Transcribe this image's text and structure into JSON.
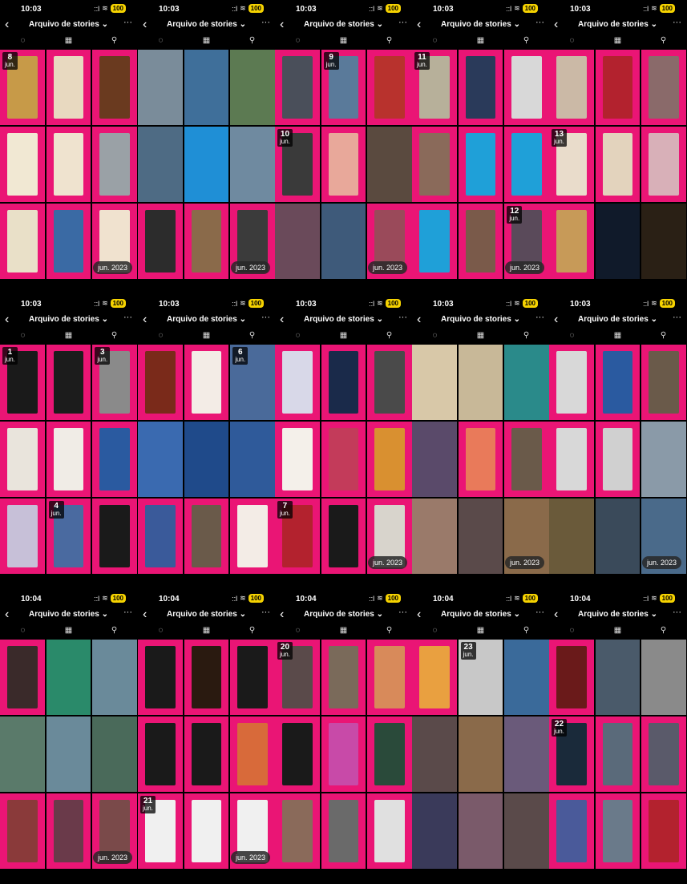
{
  "app": {
    "title": "Arquivo de stories",
    "chevron": "⌄",
    "back_icon": "chevron-left-icon",
    "more_icon": "ellipsis-icon"
  },
  "tabs": [
    {
      "icon": "stories-circle-icon",
      "glyph": "◌"
    },
    {
      "icon": "calendar-icon",
      "glyph": "▦"
    },
    {
      "icon": "location-pin-icon",
      "glyph": "⚲"
    }
  ],
  "status": {
    "signal": "::l",
    "wifi": "≋",
    "battery": "100"
  },
  "colors": {
    "pink": "#ea1575",
    "black": "#000000"
  },
  "panels": [
    {
      "time": "10:03",
      "cells": [
        {
          "t": "card",
          "c": "#c79a48",
          "d": {
            "day": "8",
            "mon": "jun."
          }
        },
        {
          "t": "card",
          "c": "#e8d9c0"
        },
        {
          "t": "card",
          "c": "#6a3a1f"
        },
        {
          "t": "card",
          "c": "#f1e8d3"
        },
        {
          "t": "card",
          "c": "#efe3cf"
        },
        {
          "t": "card",
          "c": "#9aa1a6"
        },
        {
          "t": "card",
          "c": "#e9e0c8"
        },
        {
          "t": "card",
          "c": "#3a6aa4"
        },
        {
          "t": "card",
          "c": "#f0e2cf",
          "m": "jun. 2023"
        }
      ]
    },
    {
      "time": "10:03",
      "cells": [
        {
          "t": "photo",
          "c": "#7a8c9a"
        },
        {
          "t": "photo",
          "c": "#3f6f9a"
        },
        {
          "t": "photo",
          "c": "#5c7a52"
        },
        {
          "t": "photo",
          "c": "#4e6b84"
        },
        {
          "t": "photo",
          "c": "#1f8fd6"
        },
        {
          "t": "photo",
          "c": "#6f8aa0"
        },
        {
          "t": "card",
          "c": "#2c2c2c"
        },
        {
          "t": "card",
          "c": "#8a6a4a"
        },
        {
          "t": "card",
          "c": "#3b3b3b",
          "m": "jun. 2023"
        }
      ]
    },
    {
      "time": "10:03",
      "cells": [
        {
          "t": "card",
          "c": "#4a4f5a"
        },
        {
          "t": "card",
          "c": "#5a7a9a",
          "d": {
            "day": "9",
            "mon": "jun."
          }
        },
        {
          "t": "card",
          "c": "#b8322d"
        },
        {
          "t": "card",
          "c": "#3a3a3a",
          "d": {
            "day": "10",
            "mon": "jun."
          }
        },
        {
          "t": "card",
          "c": "#e8a89a"
        },
        {
          "t": "photo",
          "c": "#5a4a3f"
        },
        {
          "t": "photo",
          "c": "#6a4a5a"
        },
        {
          "t": "photo",
          "c": "#3e5a7a"
        },
        {
          "t": "card",
          "c": "#9a4a5a",
          "m": "jun. 2023"
        }
      ]
    },
    {
      "time": "10:03",
      "cells": [
        {
          "t": "card",
          "c": "#b7b09a",
          "d": {
            "day": "11",
            "mon": "jun."
          }
        },
        {
          "t": "card",
          "c": "#2a3a5a"
        },
        {
          "t": "card",
          "c": "#d8d8d8"
        },
        {
          "t": "card",
          "c": "#8a6a5a"
        },
        {
          "t": "card",
          "c": "#1fa0d8"
        },
        {
          "t": "card",
          "c": "#1fa0d8"
        },
        {
          "t": "card",
          "c": "#1fa0d8"
        },
        {
          "t": "card",
          "c": "#7a5a4a"
        },
        {
          "t": "card",
          "c": "#5a4a5a",
          "d": {
            "day": "12",
            "mon": "jun."
          },
          "m": "jun. 2023"
        }
      ]
    },
    {
      "time": "10:03",
      "cells": [
        {
          "t": "card",
          "c": "#cbb9a6"
        },
        {
          "t": "card",
          "c": "#b3222e"
        },
        {
          "t": "card",
          "c": "#8a6a6a"
        },
        {
          "t": "card",
          "c": "#e9dccb",
          "d": {
            "day": "13",
            "mon": "jun."
          }
        },
        {
          "t": "card",
          "c": "#e3d3bd"
        },
        {
          "t": "card",
          "c": "#d8b0b8"
        },
        {
          "t": "card",
          "c": "#c79a58"
        },
        {
          "t": "photo",
          "c": "#101a2a"
        },
        {
          "t": "photo",
          "c": "#2a2015"
        }
      ]
    },
    {
      "time": "10:03",
      "cells": [
        {
          "t": "card",
          "c": "#1a1a1a",
          "d": {
            "day": "1",
            "mon": "jun."
          }
        },
        {
          "t": "card",
          "c": "#1c1c1c"
        },
        {
          "t": "card",
          "c": "#8a8a8a",
          "d": {
            "day": "3",
            "mon": "jun."
          }
        },
        {
          "t": "card",
          "c": "#e9e4dc"
        },
        {
          "t": "card",
          "c": "#f0ece6"
        },
        {
          "t": "card",
          "c": "#2a5aa0"
        },
        {
          "t": "card",
          "c": "#c7c0d8"
        },
        {
          "t": "card",
          "c": "#4a6aa0",
          "d": {
            "day": "4",
            "mon": "jun."
          }
        },
        {
          "t": "card",
          "c": "#1a1a1a"
        }
      ]
    },
    {
      "time": "10:03",
      "cells": [
        {
          "t": "card",
          "c": "#7a2a1a"
        },
        {
          "t": "card",
          "c": "#f3ece6"
        },
        {
          "t": "photo",
          "c": "#4a6a9a",
          "d": {
            "day": "6",
            "mon": "jun."
          }
        },
        {
          "t": "photo",
          "c": "#3a6ab0"
        },
        {
          "t": "photo",
          "c": "#1f4a8a"
        },
        {
          "t": "photo",
          "c": "#2f5a9a"
        },
        {
          "t": "card",
          "c": "#3a5a9a"
        },
        {
          "t": "card",
          "c": "#6a5a4a"
        },
        {
          "t": "card",
          "c": "#f3ece6"
        }
      ]
    },
    {
      "time": "10:03",
      "cells": [
        {
          "t": "card",
          "c": "#d8d8e8"
        },
        {
          "t": "card",
          "c": "#1a2a4a"
        },
        {
          "t": "card",
          "c": "#4a4a4a"
        },
        {
          "t": "card",
          "c": "#f4f0ea"
        },
        {
          "t": "card",
          "c": "#c33b5a"
        },
        {
          "t": "card",
          "c": "#d99030"
        },
        {
          "t": "card",
          "c": "#b3222e",
          "d": {
            "day": "7",
            "mon": "jun."
          }
        },
        {
          "t": "card",
          "c": "#1a1a1a"
        },
        {
          "t": "card",
          "c": "#d8d4cc",
          "m": "jun. 2023"
        }
      ]
    },
    {
      "time": "10:03",
      "cells": [
        {
          "t": "photo",
          "c": "#d8c8a8"
        },
        {
          "t": "photo",
          "c": "#c8b898"
        },
        {
          "t": "photo",
          "c": "#2a8a8a"
        },
        {
          "t": "photo",
          "c": "#5a4a6a"
        },
        {
          "t": "card",
          "c": "#e97a5a"
        },
        {
          "t": "card",
          "c": "#6a5a4a"
        },
        {
          "t": "photo",
          "c": "#9a7a6a"
        },
        {
          "t": "photo",
          "c": "#5a4a4a"
        },
        {
          "t": "photo",
          "c": "#8a6a4a",
          "m": "jun. 2023"
        }
      ]
    },
    {
      "time": "10:03",
      "cells": [
        {
          "t": "card",
          "c": "#d8d8d8"
        },
        {
          "t": "card",
          "c": "#2a5aa0"
        },
        {
          "t": "card",
          "c": "#6a5a4a"
        },
        {
          "t": "card",
          "c": "#d8d8d8"
        },
        {
          "t": "card",
          "c": "#d0d0d0"
        },
        {
          "t": "photo",
          "c": "#8a9aa8"
        },
        {
          "t": "photo",
          "c": "#6a5a3a"
        },
        {
          "t": "photo",
          "c": "#3a4a5a"
        },
        {
          "t": "photo",
          "c": "#4a6a8a",
          "m": "jun. 2023"
        }
      ]
    },
    {
      "time": "10:04",
      "cells": [
        {
          "t": "card",
          "c": "#3a2a2a"
        },
        {
          "t": "photo",
          "c": "#2a8a6a"
        },
        {
          "t": "photo",
          "c": "#6a8a9a"
        },
        {
          "t": "photo",
          "c": "#5a7a6a"
        },
        {
          "t": "photo",
          "c": "#6a8a9a"
        },
        {
          "t": "photo",
          "c": "#4a6a5a"
        },
        {
          "t": "card",
          "c": "#8a3a3a"
        },
        {
          "t": "card",
          "c": "#6a3a4a"
        },
        {
          "t": "card",
          "c": "#7a4a4a",
          "m": "jun. 2023"
        }
      ]
    },
    {
      "time": "10:04",
      "cells": [
        {
          "t": "card",
          "c": "#1a1a1a"
        },
        {
          "t": "card",
          "c": "#2a1a10"
        },
        {
          "t": "card",
          "c": "#1a1a1a"
        },
        {
          "t": "card",
          "c": "#1a1a1a"
        },
        {
          "t": "card",
          "c": "#1a1a1a"
        },
        {
          "t": "card",
          "c": "#d86a3a"
        },
        {
          "t": "card",
          "c": "#f0f0f0",
          "d": {
            "day": "21",
            "mon": "jun."
          }
        },
        {
          "t": "card",
          "c": "#f0f0f0"
        },
        {
          "t": "card",
          "c": "#f0f0f0",
          "m": "jun. 2023"
        }
      ]
    },
    {
      "time": "10:04",
      "cells": [
        {
          "t": "card",
          "c": "#5a4a4a",
          "d": {
            "day": "20",
            "mon": "jun."
          }
        },
        {
          "t": "card",
          "c": "#7a6a5a"
        },
        {
          "t": "card",
          "c": "#d88a5a"
        },
        {
          "t": "card",
          "c": "#1a1a1a"
        },
        {
          "t": "card",
          "c": "#c84aa8"
        },
        {
          "t": "card",
          "c": "#2a4a3a"
        },
        {
          "t": "card",
          "c": "#8a6a5a"
        },
        {
          "t": "card",
          "c": "#6a6a6a"
        },
        {
          "t": "card",
          "c": "#e0e0e0"
        }
      ]
    },
    {
      "time": "10:04",
      "cells": [
        {
          "t": "card",
          "c": "#e9a040"
        },
        {
          "t": "photo",
          "c": "#c8c8c8",
          "d": {
            "day": "23",
            "mon": "jun."
          }
        },
        {
          "t": "photo",
          "c": "#3a6a9a"
        },
        {
          "t": "photo",
          "c": "#5a4a4a"
        },
        {
          "t": "photo",
          "c": "#8a6a4a"
        },
        {
          "t": "photo",
          "c": "#6a5a7a"
        },
        {
          "t": "photo",
          "c": "#3a3a5a"
        },
        {
          "t": "photo",
          "c": "#7a5a6a"
        },
        {
          "t": "photo",
          "c": "#5a4a4a"
        }
      ]
    },
    {
      "time": "10:04",
      "cells": [
        {
          "t": "card",
          "c": "#6a1a1a"
        },
        {
          "t": "photo",
          "c": "#4a5a6a"
        },
        {
          "t": "photo",
          "c": "#8a8a8a"
        },
        {
          "t": "card",
          "c": "#1a2a3a",
          "d": {
            "day": "22",
            "mon": "jun."
          }
        },
        {
          "t": "card",
          "c": "#5a6a7a"
        },
        {
          "t": "card",
          "c": "#5a5a6a"
        },
        {
          "t": "card",
          "c": "#4a5a9a"
        },
        {
          "t": "card",
          "c": "#6a7a8a"
        },
        {
          "t": "card",
          "c": "#b3222e"
        }
      ]
    }
  ]
}
